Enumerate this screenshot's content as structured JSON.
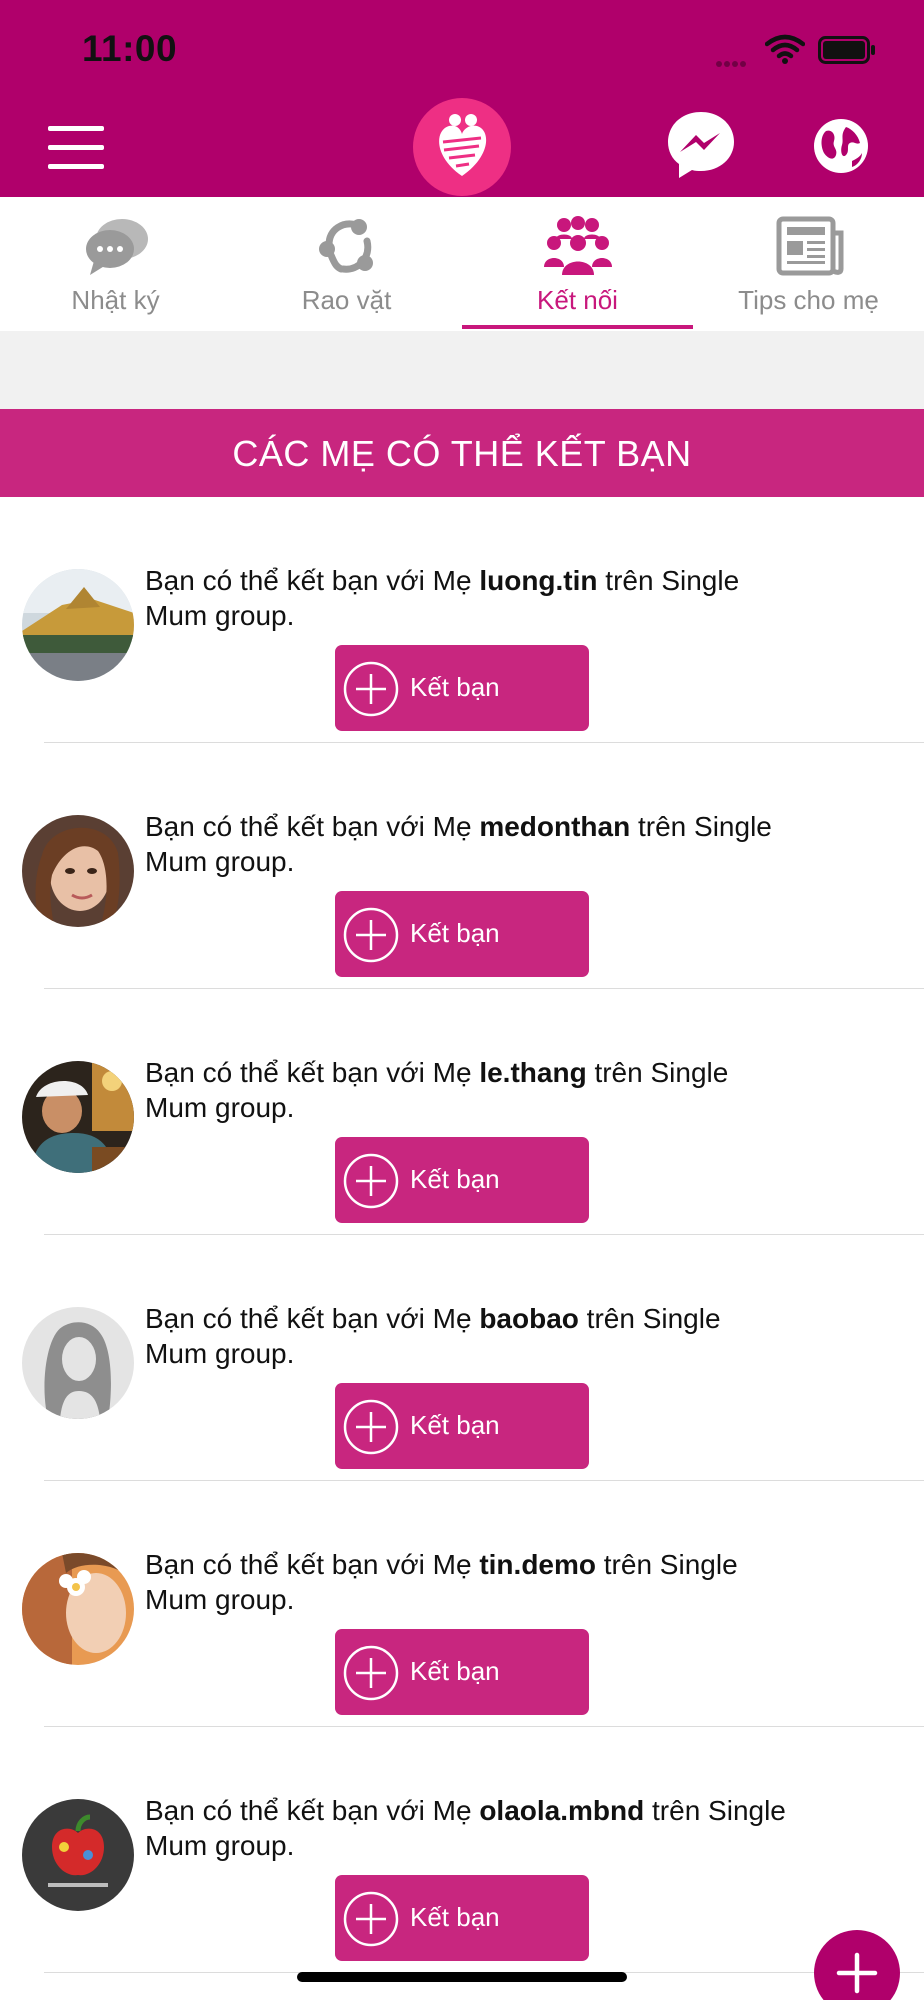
{
  "status_bar": {
    "time": "11:00"
  },
  "header": {
    "menu_icon": "hamburger-menu-icon",
    "logo_icon": "heart-family-logo",
    "messenger_icon": "messenger-icon",
    "globe_icon": "globe-icon",
    "brand_color": "#b0006b"
  },
  "tabs": [
    {
      "label": "Nhật ký",
      "icon": "chat-bubbles-icon",
      "active": false
    },
    {
      "label": "Rao vặt",
      "icon": "share-nodes-icon",
      "active": false
    },
    {
      "label": "Kết nối",
      "icon": "people-group-icon",
      "active": true
    },
    {
      "label": "Tips cho mẹ",
      "icon": "newspaper-icon",
      "active": false
    }
  ],
  "section": {
    "title": "CÁC MẸ CÓ THỂ KẾT BẠN",
    "color": "#c8267f"
  },
  "suggestions": [
    {
      "prefix": "Bạn có thể kết bạn với Mẹ",
      "username": "luong.tin",
      "suffix": "trên Single",
      "line2": "Mum group.",
      "button": "Kết bạn"
    },
    {
      "prefix": "Bạn có thể kết bạn với Mẹ",
      "username": "medonthan",
      "suffix": "trên Single",
      "line2": "Mum group.",
      "button": "Kết bạn"
    },
    {
      "prefix": "Bạn có thể kết bạn với Mẹ",
      "username": "le.thang",
      "suffix": "trên Single",
      "line2": "Mum group.",
      "button": "Kết bạn"
    },
    {
      "prefix": "Bạn có thể kết bạn với Mẹ",
      "username": "baobao",
      "suffix": "trên Single",
      "line2": "Mum group.",
      "button": "Kết bạn"
    },
    {
      "prefix": "Bạn có thể kết bạn với Mẹ",
      "username": "tin.demo",
      "suffix": "trên Single",
      "line2": "Mum group.",
      "button": "Kết bạn"
    },
    {
      "prefix": "Bạn có thể kết bạn với Mẹ",
      "username": "olaola.mbnd",
      "suffix": "trên Single",
      "line2": "Mum group.",
      "button": "Kết bạn"
    }
  ],
  "fab": {
    "icon": "plus-icon"
  }
}
